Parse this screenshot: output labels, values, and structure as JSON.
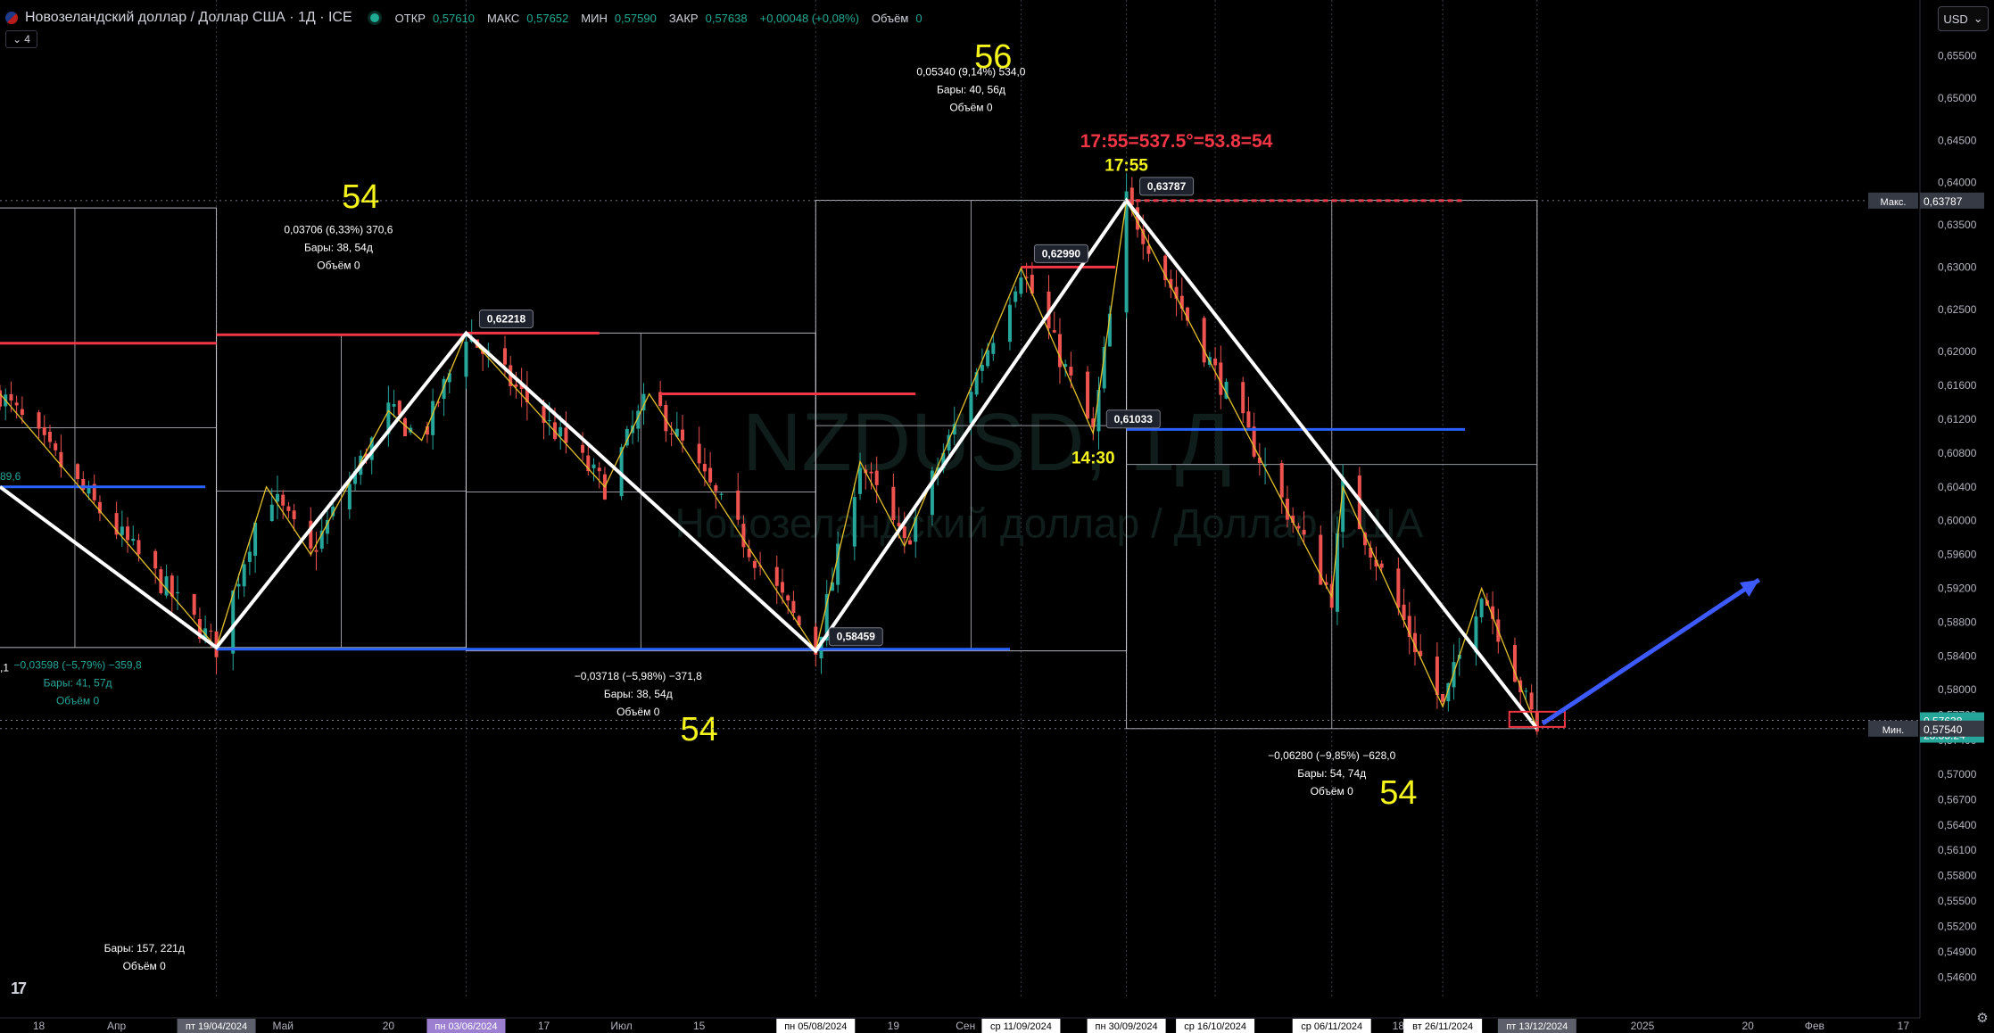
{
  "header": {
    "symbol_title": "Новозеландский доллар / Доллар США · 1Д · ICE",
    "open_label": "ОТКР",
    "open_value": "0,57610",
    "high_label": "МАКС",
    "high_value": "0,57652",
    "low_label": "МИН",
    "low_value": "0,57590",
    "close_label": "ЗАКР",
    "close_value": "0,57638",
    "change_value": "+0,00048 (+0,08%)",
    "volume_label": "Объём",
    "volume_value": "0"
  },
  "indicators_toggle": {
    "icon": "chevron-down-icon",
    "count": "4"
  },
  "currency_button": {
    "label": "USD",
    "icon": "chevron-down-icon"
  },
  "logo": {
    "text": "17",
    "icon": "tradingview-logo"
  },
  "settings": {
    "icon": "gear-icon"
  },
  "colors": {
    "background": "#000000",
    "up_candle": "#26a69a",
    "down_candle": "#ef5350",
    "zigzag": "#ffffff",
    "thin_zigzag": "#e2c12b",
    "resistance": "#f23645",
    "support": "#2962ff",
    "annotation_yellow": "#f4f41c",
    "annotation_red": "#f23645",
    "arrow": "#3d5afe"
  },
  "chart_data": {
    "type": "candlestick",
    "symbol": "NZDUSD",
    "interval": "1Д",
    "watermark": {
      "ticker": "NZDUSD, 1Д",
      "name": "Новозеландский доллар / Доллар США"
    },
    "ylim": [
      0.5434,
      0.6616
    ],
    "y_ticks": [
      0.655,
      0.65,
      0.645,
      0.64,
      0.635,
      0.63,
      0.625,
      0.62,
      0.616,
      0.612,
      0.608,
      0.604,
      0.6,
      0.596,
      0.592,
      0.588,
      0.584,
      0.58,
      0.577,
      0.574,
      0.57,
      0.567,
      0.564,
      0.561,
      0.558,
      0.555,
      0.552,
      0.549,
      0.546
    ],
    "y_tick_labels": [
      "0,65500",
      "0,65000",
      "0,64500",
      "0,64000",
      "0,63500",
      "0,63000",
      "0,62500",
      "0,62000",
      "0,61600",
      "0,61200",
      "0,60800",
      "0,60400",
      "0,60000",
      "0,59600",
      "0,59200",
      "0,58800",
      "0,58400",
      "0,58000",
      "0,57700",
      "0,57400",
      "0,57000",
      "0,56700",
      "0,56400",
      "0,56100",
      "0,55800",
      "0,55500",
      "0,55200",
      "0,54900",
      "0,54600"
    ],
    "x_range": [
      "2024-03-11",
      "2025-02-20"
    ],
    "x_ticks": [
      {
        "date": "2024-03-18",
        "label": "18"
      },
      {
        "date": "2024-04-01",
        "label": "Апр"
      },
      {
        "date": "2024-05-01",
        "label": "Май"
      },
      {
        "date": "2024-05-20",
        "label": "20"
      },
      {
        "date": "2024-06-17",
        "label": "17"
      },
      {
        "date": "2024-07-01",
        "label": "Июл"
      },
      {
        "date": "2024-07-15",
        "label": "15"
      },
      {
        "date": "2024-08-19",
        "label": "19"
      },
      {
        "date": "2024-09-01",
        "label": "Сен"
      },
      {
        "date": "2024-11-18",
        "label": "18"
      },
      {
        "date": "2025-01-01",
        "label": "2025"
      },
      {
        "date": "2025-01-20",
        "label": "20"
      },
      {
        "date": "2025-02-01",
        "label": "Фев"
      },
      {
        "date": "2025-02-17",
        "label": "17"
      }
    ],
    "x_highlight_labels": [
      {
        "date": "2024-04-19",
        "label": "пт 19/04/2024",
        "bg": "#5d606b"
      },
      {
        "date": "2024-06-03",
        "label": "пн 03/06/2024",
        "bg": "#9c7fd1"
      },
      {
        "date": "2024-08-05",
        "label": "пн 05/08/2024",
        "bg": "#ffffff"
      },
      {
        "date": "2024-09-11",
        "label": "ср 11/09/2024",
        "bg": "#ffffff"
      },
      {
        "date": "2024-09-30",
        "label": "пн 30/09/2024",
        "bg": "#ffffff"
      },
      {
        "date": "2024-10-16",
        "label": "ср 16/10/2024",
        "bg": "#ffffff"
      },
      {
        "date": "2024-11-06",
        "label": "ср 06/11/2024",
        "bg": "#ffffff"
      },
      {
        "date": "2024-11-26",
        "label": "вт 26/11/2024",
        "bg": "#ffffff"
      },
      {
        "date": "2024-12-13",
        "label": "пт 13/12/2024",
        "bg": "#5d606b"
      }
    ],
    "vertical_dotted_lines": [
      "2024-04-19",
      "2024-06-03",
      "2024-08-05",
      "2024-09-11",
      "2024-09-30",
      "2024-10-16",
      "2024-11-06",
      "2024-11-26",
      "2024-12-13"
    ],
    "price_labels": [
      {
        "tag": "Макс.",
        "value": 0.63787,
        "label": "0,63787",
        "bg": "#363a45"
      },
      {
        "tag": "",
        "value": 0.57638,
        "label": "0,57638",
        "sub": "23:35:24",
        "bg": "#26a69a"
      },
      {
        "tag": "Мин.",
        "value": 0.5754,
        "label": "0,57540",
        "bg": "#363a45"
      }
    ],
    "pivots": [
      {
        "date": "2024-03-11",
        "price": 0.604
      },
      {
        "date": "2024-04-19",
        "price": 0.585
      },
      {
        "date": "2024-06-03",
        "price": 0.62218,
        "label": "0,62218"
      },
      {
        "date": "2024-08-05",
        "price": 0.58459,
        "label": "0,58459"
      },
      {
        "date": "2024-09-11",
        "price": 0.6299,
        "label": "0,62990"
      },
      {
        "date": "2024-09-24",
        "price": 0.61033,
        "label": "0,61033"
      },
      {
        "date": "2024-09-30",
        "price": 0.63787,
        "label": "0,63787"
      },
      {
        "date": "2024-12-13",
        "price": 0.5754
      }
    ],
    "white_zigzag": [
      {
        "date": "2024-03-11",
        "price": 0.604
      },
      {
        "date": "2024-04-19",
        "price": 0.585
      },
      {
        "date": "2024-06-03",
        "price": 0.62218
      },
      {
        "date": "2024-08-05",
        "price": 0.58459
      },
      {
        "date": "2024-09-30",
        "price": 0.63787
      },
      {
        "date": "2024-12-13",
        "price": 0.5754
      }
    ],
    "thin_zigzag": [
      {
        "date": "2024-03-11",
        "price": 0.615
      },
      {
        "date": "2024-04-19",
        "price": 0.585
      },
      {
        "date": "2024-04-28",
        "price": 0.604
      },
      {
        "date": "2024-05-06",
        "price": 0.596
      },
      {
        "date": "2024-05-20",
        "price": 0.613
      },
      {
        "date": "2024-05-26",
        "price": 0.6095
      },
      {
        "date": "2024-06-03",
        "price": 0.62218
      },
      {
        "date": "2024-06-28",
        "price": 0.604
      },
      {
        "date": "2024-07-06",
        "price": 0.615
      },
      {
        "date": "2024-08-05",
        "price": 0.58459
      },
      {
        "date": "2024-08-13",
        "price": 0.607
      },
      {
        "date": "2024-08-21",
        "price": 0.597
      },
      {
        "date": "2024-09-11",
        "price": 0.6299
      },
      {
        "date": "2024-09-24",
        "price": 0.61033
      },
      {
        "date": "2024-09-30",
        "price": 0.63787
      },
      {
        "date": "2024-11-06",
        "price": 0.591
      },
      {
        "date": "2024-11-08",
        "price": 0.604
      },
      {
        "date": "2024-11-26",
        "price": 0.578
      },
      {
        "date": "2024-12-03",
        "price": 0.592
      },
      {
        "date": "2024-12-13",
        "price": 0.5754
      }
    ],
    "resistance_lines": [
      {
        "from": "2024-03-11",
        "to": "2024-04-19",
        "price": 0.621
      },
      {
        "from": "2024-04-19",
        "to": "2024-06-03",
        "price": 0.622
      },
      {
        "from": "2024-06-03",
        "to": "2024-06-27",
        "price": 0.6222
      },
      {
        "from": "2024-07-08",
        "to": "2024-08-23",
        "price": 0.615
      },
      {
        "from": "2024-09-11",
        "to": "2024-09-28",
        "price": 0.63
      },
      {
        "from": "2024-09-30",
        "to": "2024-11-30",
        "price": 0.63787,
        "dashed": true
      }
    ],
    "support_lines": [
      {
        "from": "2024-03-11",
        "to": "2024-04-17",
        "price": 0.604
      },
      {
        "from": "2024-04-19",
        "to": "2024-09-09",
        "price": 0.5848
      },
      {
        "from": "2024-09-30",
        "to": "2024-11-30",
        "price": 0.6108
      }
    ],
    "measure_boxes": [
      {
        "from": "2024-02-28",
        "to": "2024-04-19",
        "p_top": 0.637,
        "p_bottom": 0.585
      },
      {
        "from": "2024-04-19",
        "to": "2024-06-03",
        "p_top": 0.622,
        "p_bottom": 0.585
      },
      {
        "from": "2024-06-03",
        "to": "2024-08-05",
        "p_top": 0.6222,
        "p_bottom": 0.5846
      },
      {
        "from": "2024-08-05",
        "to": "2024-09-30",
        "p_top": 0.6379,
        "p_bottom": 0.5846
      },
      {
        "from": "2024-09-30",
        "to": "2024-12-13",
        "p_top": 0.6379,
        "p_bottom": 0.5754
      }
    ],
    "measure_stats": [
      {
        "date": "2024-03-25",
        "price": 0.5825,
        "lines": [
          "−0,03598 (−5,79%) −359,8",
          "Бары: 41, 57д",
          "Объём 0"
        ],
        "color": "#26a69a"
      },
      {
        "date": "2024-05-11",
        "price": 0.634,
        "lines": [
          "0,03706 (6,33%) 370,6",
          "Бары: 38, 54д",
          "Объём 0"
        ],
        "color": "#ffffff"
      },
      {
        "date": "2024-07-04",
        "price": 0.5812,
        "lines": [
          "−0,03718 (−5,98%) −371,8",
          "Бары: 38, 54д",
          "Объём 0"
        ],
        "color": "#ffffff"
      },
      {
        "date": "2024-09-02",
        "price": 0.6527,
        "lines": [
          "0,05340 (9,14%) 534,0",
          "Бары: 40, 56д",
          "Объём 0"
        ],
        "color": "#ffffff"
      },
      {
        "date": "2024-11-06",
        "price": 0.5718,
        "lines": [
          "−0,06280 (−9,85%) −628,0",
          "Бары: 54, 74д",
          "Объём 0"
        ],
        "color": "#ffffff"
      },
      {
        "date": "2024-04-06",
        "price": 0.549,
        "lines": [
          "Бары: 157, 221д",
          "Объём 0"
        ],
        "color": "#ffffff"
      }
    ],
    "left_edge_labels": [
      {
        "price": 0.6048,
        "text": "89,6",
        "color": "#26a69a"
      },
      {
        "price": 0.5822,
        "text": ",1",
        "color": "#ffffff"
      }
    ],
    "annotations": [
      {
        "date": "2024-05-15",
        "price": 0.637,
        "text": "54",
        "color": "#f4f41c",
        "size": 38
      },
      {
        "date": "2024-07-15",
        "price": 0.574,
        "text": "54",
        "color": "#f4f41c",
        "size": 38
      },
      {
        "date": "2024-09-06",
        "price": 0.6536,
        "text": "56",
        "color": "#f4f41c",
        "size": 38
      },
      {
        "date": "2024-11-18",
        "price": 0.5665,
        "text": "54",
        "color": "#f4f41c",
        "size": 38
      },
      {
        "date": "2024-10-09",
        "price": 0.6442,
        "text": "17:55=537.5°=53.8=54",
        "color": "#f23645",
        "size": 21
      },
      {
        "date": "2024-09-30",
        "price": 0.6414,
        "text": "17:55",
        "color": "#f4f41c",
        "size": 19
      },
      {
        "date": "2024-09-24",
        "price": 0.6068,
        "text": "14:30",
        "color": "#f4f41c",
        "size": 19
      }
    ],
    "projection_arrow": {
      "from": {
        "date": "2024-12-14",
        "price": 0.576
      },
      "to": {
        "date": "2025-01-22",
        "price": 0.593
      }
    },
    "target_box": {
      "from": "2024-12-08",
      "to": "2024-12-18",
      "p_top": 0.5774,
      "p_bottom": 0.5756
    },
    "candles_down_fraction": 0.5
  }
}
